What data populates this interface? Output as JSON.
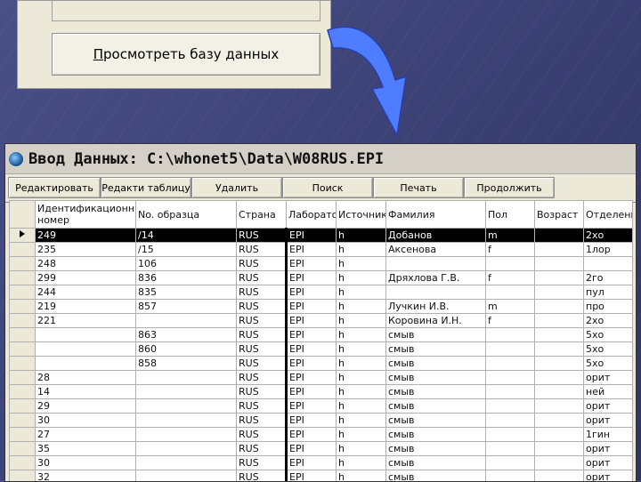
{
  "menu": {
    "item_prefix": "П",
    "item_rest": "росмотреть базу данных"
  },
  "window": {
    "title": "Ввод Данных:  C:\\whonet5\\Data\\W08RUS.EPI",
    "toolbar": [
      {
        "label": "Редактировать",
        "name": "edit-button"
      },
      {
        "label": "Редакти таблицу",
        "name": "edit-table-button"
      },
      {
        "label": "Удалить",
        "name": "delete-button"
      },
      {
        "label": "Поиск",
        "name": "search-button"
      },
      {
        "label": "Печать",
        "name": "print-button"
      },
      {
        "label": "Продолжить",
        "name": "continue-button"
      }
    ],
    "columns": [
      "Идентификационный номер",
      "No. образца",
      "Страна",
      "Лаборатория",
      "Источник",
      "Фамилия",
      "Пол",
      "Возраст",
      "Отделение"
    ],
    "rows": [
      [
        "249",
        "/14",
        "RUS",
        "EPI",
        "h",
        "Добанов",
        "m",
        "",
        "2хо"
      ],
      [
        "235",
        "/15",
        "RUS",
        "EPI",
        "h",
        "Аксенова",
        "f",
        "",
        "1лор"
      ],
      [
        "248",
        "106",
        "RUS",
        "EPI",
        "h",
        "",
        "",
        "",
        ""
      ],
      [
        "299",
        "836",
        "RUS",
        "EPI",
        "h",
        "Дряхлова Г.В.",
        "f",
        "",
        "2го"
      ],
      [
        "244",
        "835",
        "RUS",
        "EPI",
        "h",
        "",
        "",
        "",
        "пул"
      ],
      [
        "219",
        "857",
        "RUS",
        "EPI",
        "h",
        "Лучкин И.В.",
        "m",
        "",
        "про"
      ],
      [
        "221",
        "",
        "RUS",
        "EPI",
        "h",
        "Коровина И.Н.",
        "f",
        "",
        "2хо"
      ],
      [
        "",
        "863",
        "RUS",
        "EPI",
        "h",
        "смыв",
        "",
        "",
        "5хо"
      ],
      [
        "",
        "860",
        "RUS",
        "EPI",
        "h",
        "смыв",
        "",
        "",
        "5хо"
      ],
      [
        "",
        "858",
        "RUS",
        "EPI",
        "h",
        "смыв",
        "",
        "",
        "5хо"
      ],
      [
        "28",
        "",
        "RUS",
        "EPI",
        "h",
        "смыв",
        "",
        "",
        "орит"
      ],
      [
        "14",
        "",
        "RUS",
        "EPI",
        "h",
        "смыв",
        "",
        "",
        "ней"
      ],
      [
        "29",
        "",
        "RUS",
        "EPI",
        "h",
        "смыв",
        "",
        "",
        "орит"
      ],
      [
        "30",
        "",
        "RUS",
        "EPI",
        "h",
        "смыв",
        "",
        "",
        "орит"
      ],
      [
        "27",
        "",
        "RUS",
        "EPI",
        "h",
        "смыв",
        "",
        "",
        "1гин"
      ],
      [
        "35",
        "",
        "RUS",
        "EPI",
        "h",
        "смыв",
        "",
        "",
        "орит"
      ],
      [
        "30",
        "",
        "RUS",
        "EPI",
        "h",
        "смыв",
        "",
        "",
        "орит"
      ],
      [
        "32",
        "",
        "RUS",
        "EPI",
        "h",
        "смыв",
        "",
        "",
        "орит"
      ]
    ]
  },
  "colors": {
    "background": "#3f447a",
    "arrow_fill": "#4f7dff",
    "selection": "#000000"
  }
}
